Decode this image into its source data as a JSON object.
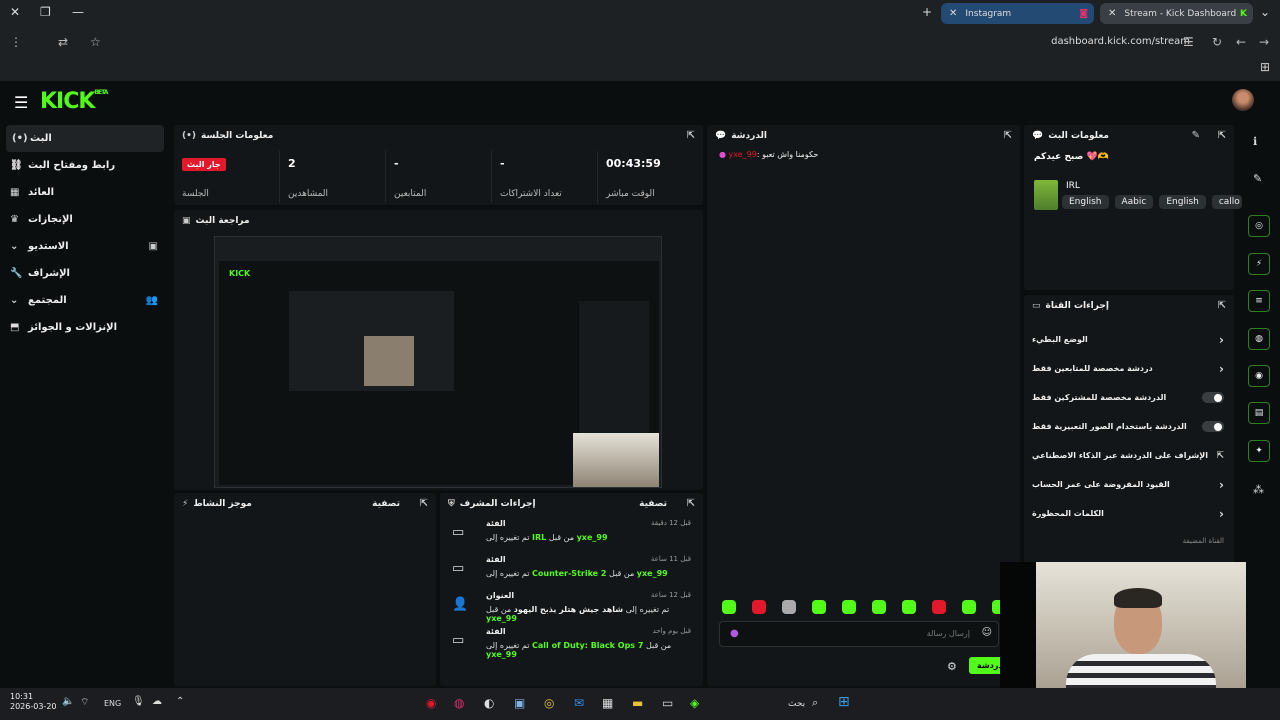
{
  "browser": {
    "tabs": [
      {
        "label": "Instagram"
      },
      {
        "label": "Stream - Kick Dashboard"
      }
    ],
    "url": "dashboard.kick.com/stream"
  },
  "header": {
    "logo": "KICK",
    "logo_badge": "BETA"
  },
  "sidebar": {
    "items": [
      {
        "label": "البث"
      },
      {
        "label": "رابط ومفتاح البث"
      },
      {
        "label": "العائد"
      },
      {
        "label": "الإنجازات"
      },
      {
        "label": "الاستديو"
      },
      {
        "label": "الإشراف"
      },
      {
        "label": "المجتمع"
      },
      {
        "label": "الإنزالات و الجوائز"
      }
    ]
  },
  "session": {
    "title": "معلومات الجلسة",
    "live_badge": "جار البث",
    "session_label": "الجلسة",
    "viewers_value": "2",
    "viewers_label": "المشاهدين",
    "followers_value": "-",
    "followers_label": "المتابعين",
    "subs_value": "-",
    "subs_label": "تعداد الاشتراكات",
    "time_value": "00:43:59",
    "time_label": "الوقت مباشر"
  },
  "preview": {
    "title": "مراجعة البث"
  },
  "activity": {
    "title": "موجز النشاط",
    "filter": "تصفية"
  },
  "mod_actions": {
    "title": "إجراءات المشرف",
    "filter": "تصفية",
    "rows": [
      {
        "kind": "الفئة",
        "prefix": "تم تغييره إلى",
        "value": "IRL",
        "by": "من قبل",
        "user": "yxe_99",
        "time": "قبل 12 دقيقة"
      },
      {
        "kind": "الفئة",
        "prefix": "تم تغييره إلى",
        "value": "Counter-Strike 2",
        "by": "من قبل",
        "user": "yxe_99",
        "time": "قبل 11 ساعة"
      },
      {
        "kind": "العنوان",
        "prefix": "تم تغييره إلى",
        "value": "شاهد جيش هتلر يذبح اليهود",
        "by": "من قبل",
        "user": "yxe_99",
        "time": "قبل 12 ساعة"
      },
      {
        "kind": "الفئة",
        "prefix": "تم تغييره إلى",
        "value": "Call of Duty: Black Ops 7",
        "by": "من قبل",
        "user": "yxe_99",
        "time": "قبل يوم واحد"
      }
    ]
  },
  "chat": {
    "title": "الدردشة",
    "message_user": "yxe_99",
    "message_text": "حكومنا واش تعبو",
    "input_placeholder": "إرسال رسالة",
    "send_label": "الدردشة"
  },
  "stream_info": {
    "title": "معلومات البث",
    "stream_title": "صبح عيدكم 💖🫶",
    "category": "IRL",
    "tags": [
      "English",
      "Aabic",
      "English",
      "callo"
    ]
  },
  "channel_actions": {
    "title": "إجراءات القناة",
    "rows": [
      {
        "label": "الوضع البطيء"
      },
      {
        "label": "دردشة مخصصة للمتابعين فقط"
      },
      {
        "label": "الدردشة مخصصة للمشتركين فقط"
      },
      {
        "label": "الدردشة باستخدام الصور التعبيرية فقط"
      },
      {
        "label": "الإشراف على الدردشة عبر الذكاء الاصطناعي"
      },
      {
        "label": "القيود المفروضة على عمر الحساب"
      },
      {
        "label": "الكلمات المحظورة"
      }
    ],
    "footer": "القناة المضيفة"
  },
  "taskbar": {
    "time": "10:31",
    "date": "2026-03-20",
    "lang": "ENG",
    "search": "بحث"
  },
  "colors": {
    "accent": "#53fc18",
    "live": "#e1192b",
    "bg": "#0b0e0f",
    "panel": "#131618"
  }
}
